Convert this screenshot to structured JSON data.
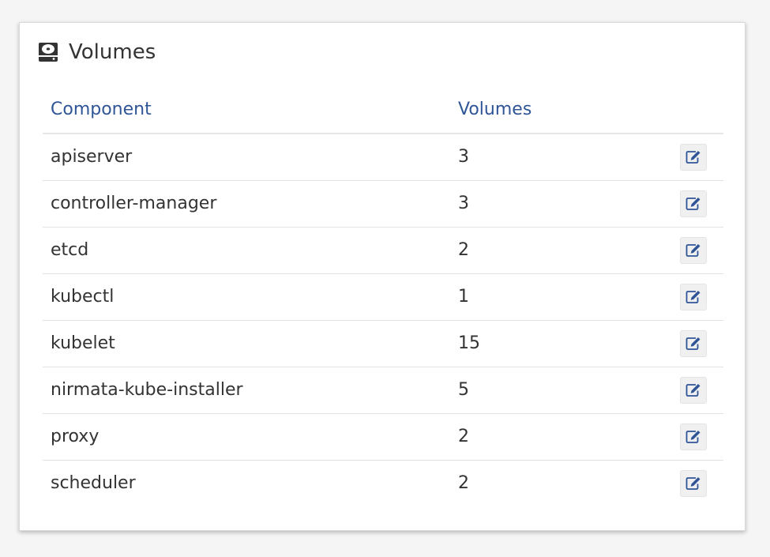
{
  "panel": {
    "title": "Volumes",
    "icon": "hard-drive-icon"
  },
  "table": {
    "headers": {
      "component": "Component",
      "volumes": "Volumes"
    },
    "rows": [
      {
        "component": "apiserver",
        "volumes": "3"
      },
      {
        "component": "controller-manager",
        "volumes": "3"
      },
      {
        "component": "etcd",
        "volumes": "2"
      },
      {
        "component": "kubectl",
        "volumes": "1"
      },
      {
        "component": "kubelet",
        "volumes": "15"
      },
      {
        "component": "nirmata-kube-installer",
        "volumes": "5"
      },
      {
        "component": "proxy",
        "volumes": "2"
      },
      {
        "component": "scheduler",
        "volumes": "2"
      }
    ],
    "row_action_icon": "edit-icon"
  },
  "colors": {
    "header_text": "#2f5597",
    "body_text": "#333333",
    "edit_icon": "#2f5597"
  }
}
